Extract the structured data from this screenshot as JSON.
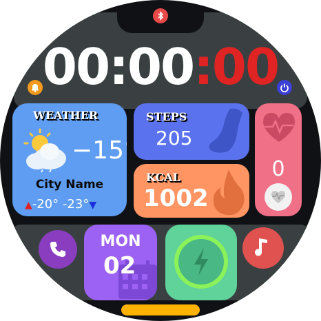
{
  "time": {
    "hours_minutes": "00:00",
    "separator": ":",
    "seconds": "00"
  },
  "weather": {
    "title": "WEATHER",
    "temperature": "−15°",
    "city": "City Name",
    "high": "-20°",
    "low": "-23°"
  },
  "steps": {
    "title": "STEPS",
    "value": "205"
  },
  "kcal": {
    "title": "KCAL",
    "value": "1002"
  },
  "heart_rate": {
    "value": "0"
  },
  "date": {
    "weekday": "MON",
    "day": "02"
  },
  "colors": {
    "seconds": "#e02424",
    "weather_tile": "#5e9df2",
    "steps_tile": "#5b72ee",
    "kcal_tile": "#ff9563",
    "heart_tile": "#f07088",
    "date_tile": "#9b62f3",
    "charge_tile": "#5fd39a"
  },
  "icons": [
    "bluetooth-icon",
    "alarm-icon",
    "power-icon",
    "cloud-sun-icon",
    "shoe-icon",
    "flame-icon",
    "heart-pulse-icon",
    "phone-icon",
    "calendar-icon",
    "bolt-icon",
    "music-note-icon"
  ]
}
